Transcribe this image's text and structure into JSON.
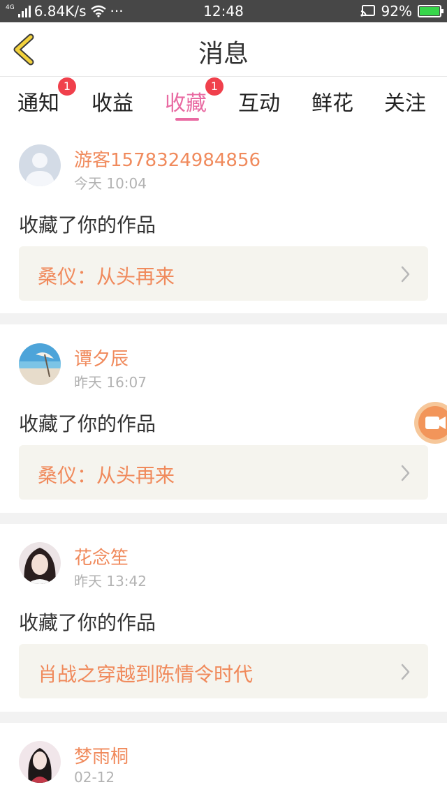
{
  "status_bar": {
    "network_type": "4G",
    "speed": "6.84K/s",
    "more": "···",
    "time": "12:48",
    "battery_percent": "92%"
  },
  "header": {
    "title": "消息",
    "back_icon": "chevron-left-icon"
  },
  "tabs": [
    {
      "label": "通知",
      "badge": "1"
    },
    {
      "label": "收益",
      "badge": ""
    },
    {
      "label": "收藏",
      "badge": "1",
      "active": true
    },
    {
      "label": "互动",
      "badge": ""
    },
    {
      "label": "鲜花",
      "badge": ""
    },
    {
      "label": "关注",
      "badge": ""
    }
  ],
  "messages": [
    {
      "user": "游客1578324984856",
      "time": "今天 10:04",
      "action": "收藏了你的作品",
      "work": "桑仪：从头再来"
    },
    {
      "user": "谭夕辰",
      "time": "昨天 16:07",
      "action": "收藏了你的作品",
      "work": "桑仪：从头再来"
    },
    {
      "user": "花念笙",
      "time": "昨天 13:42",
      "action": "收藏了你的作品",
      "work": "肖战之穿越到陈情令时代"
    },
    {
      "user": "梦雨桐",
      "time": "02-12"
    }
  ],
  "colors": {
    "accent_pink": "#e96aa2",
    "username_orange": "#f08a5c",
    "badge_red": "#f0404c",
    "back_yellow": "#f3d23d"
  }
}
